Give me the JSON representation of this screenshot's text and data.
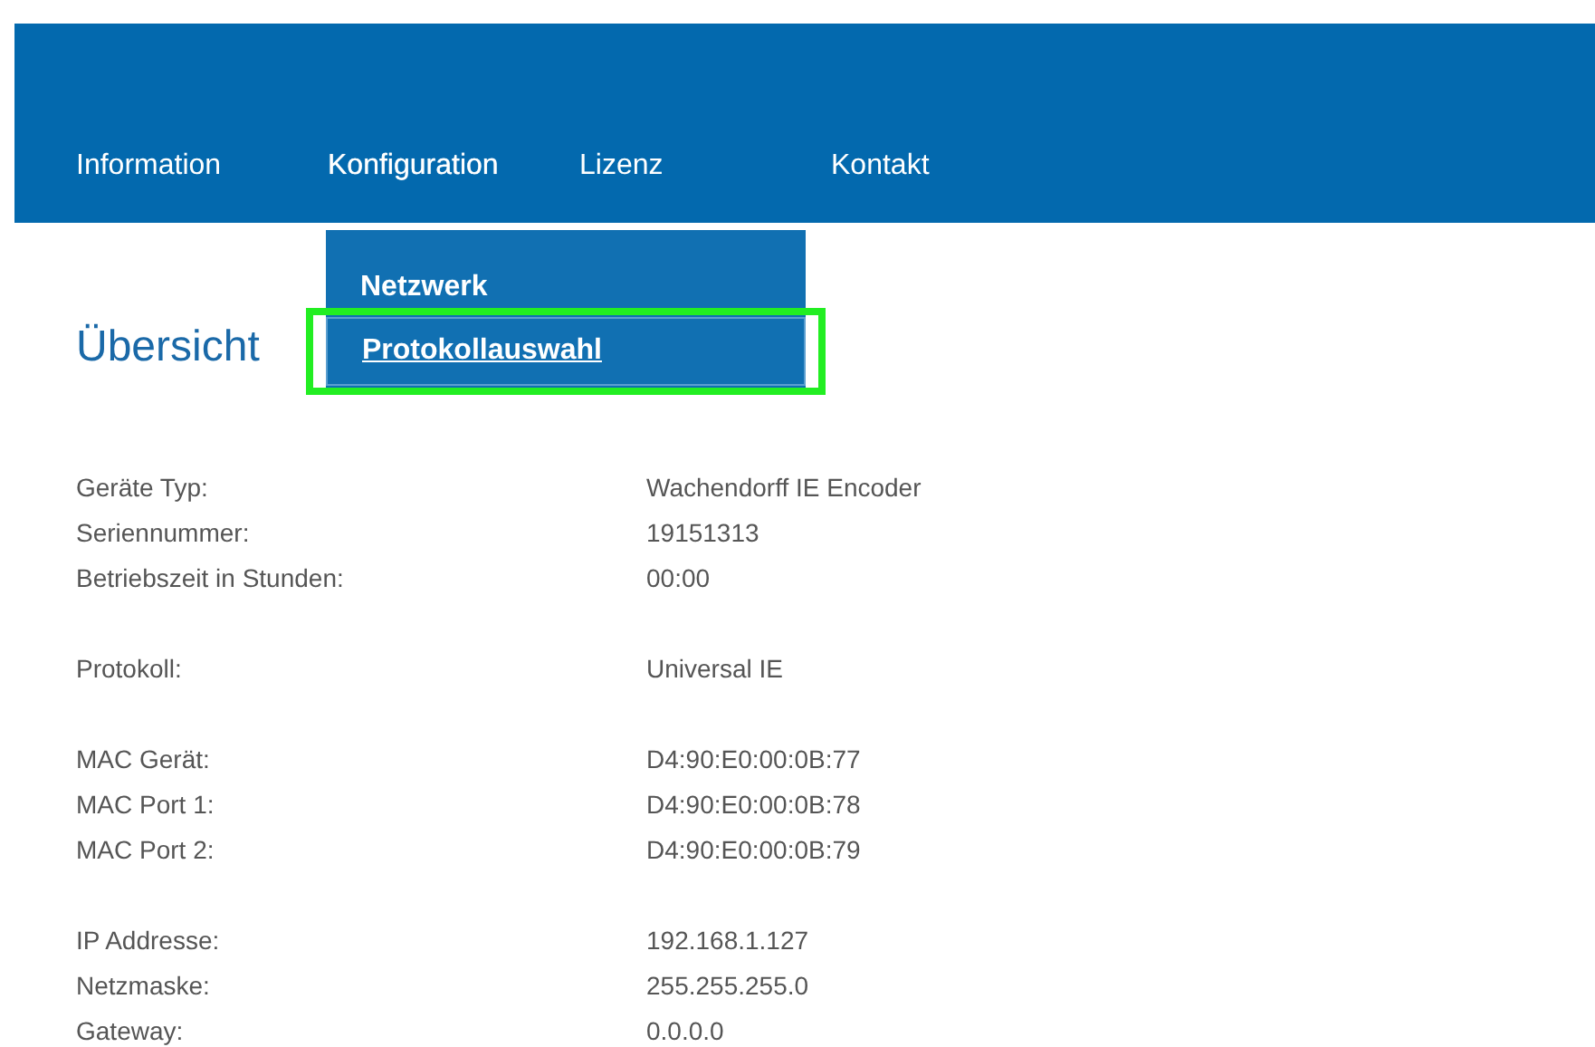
{
  "nav": [
    {
      "label": "Information",
      "open": false
    },
    {
      "label": "Konfiguration",
      "open": true
    },
    {
      "label": "Lizenz",
      "open": false
    },
    {
      "label": "Kontakt",
      "open": false
    }
  ],
  "dropdown": [
    {
      "label": "Netzwerk",
      "selected": false
    },
    {
      "label": "Protokollauswahl",
      "selected": true
    }
  ],
  "title": "Übersicht",
  "groups": [
    [
      {
        "label": "Geräte Typ:",
        "value": "Wachendorff IE Encoder"
      },
      {
        "label": "Seriennummer:",
        "value": "19151313"
      },
      {
        "label": "Betriebszeit in Stunden:",
        "value": "00:00"
      }
    ],
    [
      {
        "label": "Protokoll:",
        "value": "Universal IE"
      }
    ],
    [
      {
        "label": "MAC Gerät:",
        "value": "D4:90:E0:00:0B:77"
      },
      {
        "label": "MAC Port 1:",
        "value": "D4:90:E0:00:0B:78"
      },
      {
        "label": "MAC Port 2:",
        "value": "D4:90:E0:00:0B:79"
      }
    ],
    [
      {
        "label": "IP Addresse:",
        "value": "192.168.1.127"
      },
      {
        "label": "Netzmaske:",
        "value": "255.255.255.0"
      },
      {
        "label": "Gateway:",
        "value": "0.0.0.0"
      }
    ]
  ]
}
